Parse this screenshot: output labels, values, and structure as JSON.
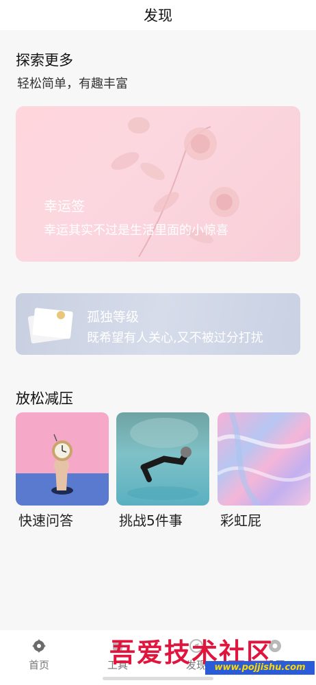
{
  "header": {
    "title": "发现"
  },
  "explore": {
    "title": "探索更多",
    "subtitle": "轻松简单，有趣丰富"
  },
  "luck_card": {
    "title": "幸运签",
    "desc": "幸运其实不过是生活里面的小惊喜"
  },
  "lonely_card": {
    "title": "孤独等级",
    "desc": "既希望有人关心,又不被过分打扰"
  },
  "relax": {
    "title": "放松减压",
    "items": [
      {
        "label": "快速问答"
      },
      {
        "label": "挑战5件事"
      },
      {
        "label": "彩虹屁"
      }
    ]
  },
  "tabbar": {
    "items": [
      {
        "label": "首页",
        "icon": "gear-icon"
      },
      {
        "label": "工具",
        "icon": "tools-icon"
      },
      {
        "label": "发现",
        "icon": "discover-icon"
      },
      {
        "label": "设置",
        "icon": "settings-icon"
      }
    ]
  },
  "watermark": {
    "text": "吾爱技术社区",
    "url": "www.pojjishu.com"
  },
  "colors": {
    "accent_red": "#e0143c",
    "luck_pink": "#fcd7df",
    "tab_text": "#777777"
  }
}
